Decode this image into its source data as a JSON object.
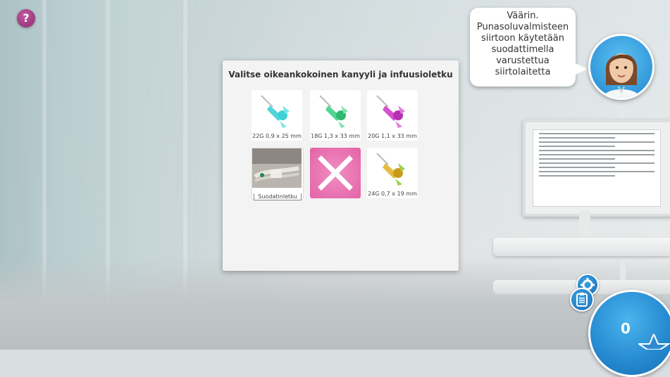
{
  "help_button": {
    "label": "?"
  },
  "speech": {
    "lines": [
      "Väärin.",
      "Punasoluvalmisteen",
      "siirtoon käytetään",
      "suodattimella",
      "varustettua",
      "siirtolaitetta"
    ]
  },
  "dialog": {
    "title": "Valitse oikeankokoinen kanyyli ja infuusioletku",
    "options": [
      {
        "label": "22G 0,9 x 25 mm",
        "color": "#3fd1d6"
      },
      {
        "label": "18G 1,3 x 33 mm",
        "color": "#3ed08a"
      },
      {
        "label": "20G 1,1 x 33 mm",
        "color": "#cf3fc7"
      },
      {
        "label": "Suodatinletku",
        "color": "#9aa"
      },
      {
        "label": "",
        "state": "rejected",
        "color": "#e463a8"
      },
      {
        "label": "24G 0,7 x 19 mm",
        "color": "#e0b52c"
      }
    ]
  },
  "score": {
    "value": "0"
  },
  "colors": {
    "accent_blue": "#2488cf",
    "help_purple": "#8f2a73",
    "reject_pink": "#e463a8"
  },
  "icons": [
    "help-icon",
    "clipboard-icon",
    "gear-icon",
    "star-icon",
    "close-icon"
  ]
}
